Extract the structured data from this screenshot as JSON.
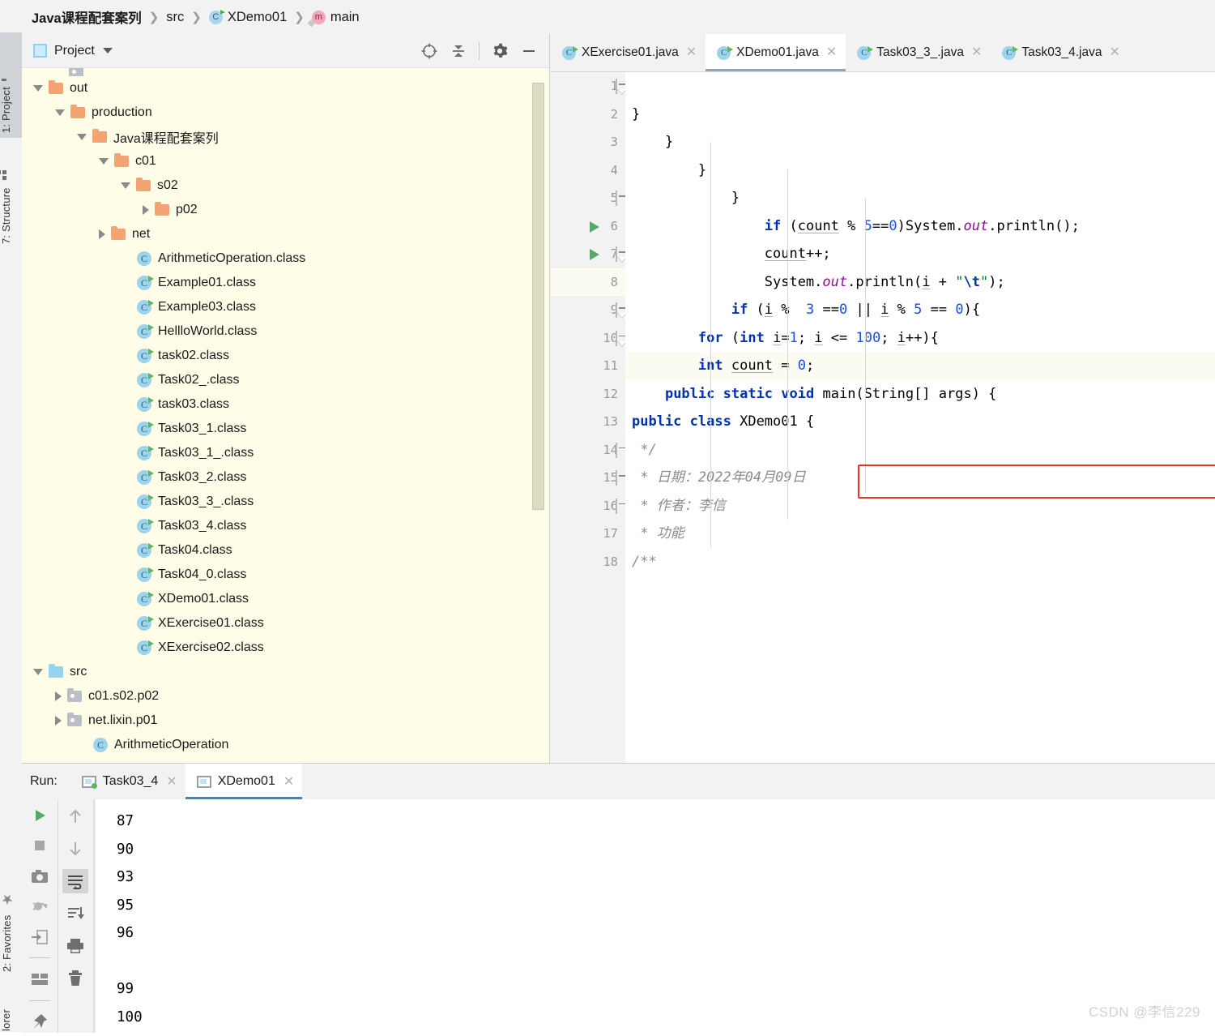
{
  "breadcrumb": [
    {
      "label": "Java课程配套案列",
      "icon": "none",
      "bold": true
    },
    {
      "label": "src",
      "icon": "none",
      "bold": false
    },
    {
      "label": "XDemo01",
      "icon": "class-icon",
      "bold": false
    },
    {
      "label": "main",
      "icon": "method-icon",
      "bold": false
    }
  ],
  "left_strip": {
    "project_tab": "1: Project",
    "structure_tab": "7: Structure",
    "favorites_tab": "2: Favorites",
    "explorer_tab": "lorer"
  },
  "project_panel": {
    "title": "Project",
    "tools": [
      "locate-icon",
      "collapse-all-icon",
      "settings-icon",
      "minimize-icon"
    ],
    "tree": [
      {
        "label": "out",
        "indent": 1,
        "arrow": "down",
        "icon": "folder-orange"
      },
      {
        "label": "production",
        "indent": 2,
        "arrow": "down",
        "icon": "folder-orange"
      },
      {
        "label": "Java课程配套案列",
        "indent": 3,
        "arrow": "down",
        "icon": "folder-orange"
      },
      {
        "label": "c01",
        "indent": 4,
        "arrow": "down",
        "icon": "folder-orange"
      },
      {
        "label": "s02",
        "indent": 5,
        "arrow": "down",
        "icon": "folder-orange"
      },
      {
        "label": "p02",
        "indent": 6,
        "arrow": "right",
        "icon": "folder-orange"
      },
      {
        "label": "net",
        "indent": 4,
        "arrow": "right",
        "icon": "folder-orange"
      },
      {
        "label": "ArithmeticOperation.class",
        "indent": 5,
        "arrow": "none",
        "icon": "class-plain"
      },
      {
        "label": "Example01.class",
        "indent": 5,
        "arrow": "none",
        "icon": "class-run"
      },
      {
        "label": "Example03.class",
        "indent": 5,
        "arrow": "none",
        "icon": "class-run"
      },
      {
        "label": "HellloWorld.class",
        "indent": 5,
        "arrow": "none",
        "icon": "class-run"
      },
      {
        "label": "task02.class",
        "indent": 5,
        "arrow": "none",
        "icon": "class-run"
      },
      {
        "label": "Task02_.class",
        "indent": 5,
        "arrow": "none",
        "icon": "class-run"
      },
      {
        "label": "task03.class",
        "indent": 5,
        "arrow": "none",
        "icon": "class-run"
      },
      {
        "label": "Task03_1.class",
        "indent": 5,
        "arrow": "none",
        "icon": "class-run"
      },
      {
        "label": "Task03_1_.class",
        "indent": 5,
        "arrow": "none",
        "icon": "class-run"
      },
      {
        "label": "Task03_2.class",
        "indent": 5,
        "arrow": "none",
        "icon": "class-run"
      },
      {
        "label": "Task03_3_.class",
        "indent": 5,
        "arrow": "none",
        "icon": "class-run"
      },
      {
        "label": "Task03_4.class",
        "indent": 5,
        "arrow": "none",
        "icon": "class-run"
      },
      {
        "label": "Task04.class",
        "indent": 5,
        "arrow": "none",
        "icon": "class-run"
      },
      {
        "label": "Task04_0.class",
        "indent": 5,
        "arrow": "none",
        "icon": "class-run"
      },
      {
        "label": "XDemo01.class",
        "indent": 5,
        "arrow": "none",
        "icon": "class-run"
      },
      {
        "label": "XExercise01.class",
        "indent": 5,
        "arrow": "none",
        "icon": "class-run"
      },
      {
        "label": "XExercise02.class",
        "indent": 5,
        "arrow": "none",
        "icon": "class-run"
      },
      {
        "label": "src",
        "indent": 1,
        "arrow": "down",
        "icon": "folder-blue"
      },
      {
        "label": "c01.s02.p02",
        "indent": 2,
        "arrow": "right",
        "icon": "folder-gray"
      },
      {
        "label": "net.lixin.p01",
        "indent": 2,
        "arrow": "right",
        "icon": "folder-gray"
      },
      {
        "label": "ArithmeticOperation",
        "indent": 3,
        "arrow": "none",
        "icon": "class-plain"
      }
    ]
  },
  "editor": {
    "tabs": [
      {
        "label": "XExercise01.java",
        "active": false
      },
      {
        "label": "XDemo01.java",
        "active": true
      },
      {
        "label": "Task03_3_.java",
        "active": false
      },
      {
        "label": "Task03_4.java",
        "active": false
      }
    ],
    "line_numbers": [
      1,
      2,
      3,
      4,
      5,
      6,
      7,
      8,
      9,
      10,
      11,
      12,
      13,
      14,
      15,
      16,
      17,
      18
    ],
    "current_line": 8,
    "run_arrow_lines": [
      6,
      7
    ],
    "code": [
      "/**",
      " * 功能",
      " * 作者：李信",
      " * 日期：2022年04月09日",
      " */",
      "public class XDemo01 {",
      "    public static void main(String[] args) {",
      "        int count = 0;",
      "        for (int i=1; i <= 100; i++){",
      "            if (i %  3 ==0 || i % 5 == 0){",
      "                System.out.println(i + \"\\t\");",
      "                count++;",
      "                if (count % 5==0)System.out.println();",
      "            }",
      "        }",
      "    }",
      "}",
      ""
    ],
    "annotation": {
      "type": "red-rectangle",
      "line": 13,
      "color": "#e8332a"
    }
  },
  "run_panel": {
    "label": "Run:",
    "tabs": [
      {
        "label": "Task03_4",
        "active": false,
        "status": "green-dot"
      },
      {
        "label": "XDemo01",
        "active": true,
        "status": "none"
      }
    ],
    "toolbar_left": [
      "rerun-icon",
      "stop-icon",
      "camera-icon",
      "debug-icon",
      "export-icon",
      "layout-icon",
      "pin-icon"
    ],
    "toolbar_right": [
      "up-arrow-icon",
      "down-arrow-icon",
      "soft-wrap-icon",
      "scroll-to-end-icon",
      "print-icon",
      "trash-icon"
    ],
    "console_output": [
      "87",
      "90",
      "93",
      "95",
      "96",
      "",
      "99",
      "100"
    ]
  },
  "watermark": "CSDN @李信229",
  "colors": {
    "keyword": "#0033b3",
    "number": "#1750eb",
    "string": "#067d17",
    "comment": "#8c8c8c",
    "field": "#871094",
    "annotation": "#e8332a",
    "tree_bg": "#fffce8",
    "active_tab_underline": "#3a82d6"
  }
}
